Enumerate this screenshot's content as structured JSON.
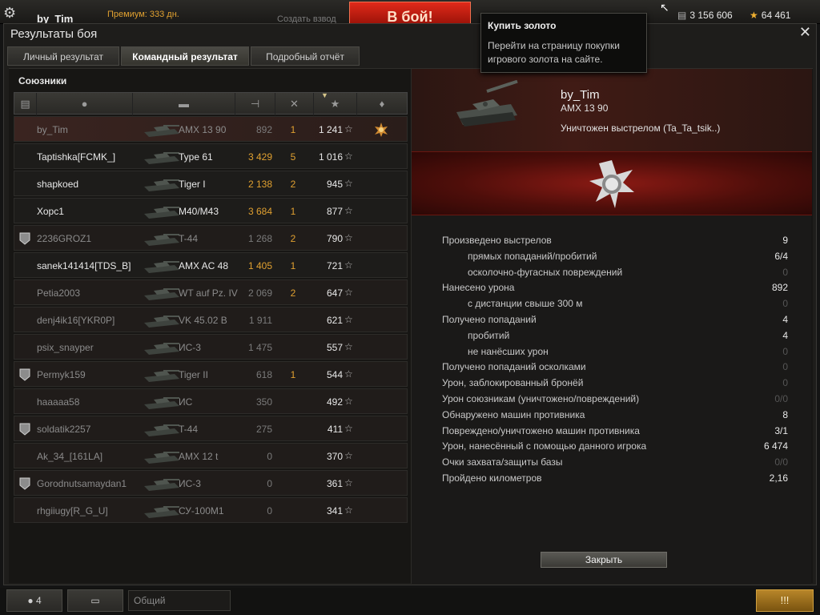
{
  "topbar": {
    "username": "by_Tim",
    "premium": "Премиум: 333 дн.",
    "create_platoon": "Создать взвод",
    "battle_button": "В бой!",
    "credits": "3 156 606",
    "gold": "64 461",
    "icons": {
      "settings": "gear-icon",
      "credits": "coins-icon",
      "gold": "gold-star-icon"
    }
  },
  "window": {
    "title": "Результаты боя",
    "close_glyph": "✕",
    "tabs": [
      {
        "label": "Личный результат"
      },
      {
        "label": "Командный результат"
      },
      {
        "label": "Подробный отчёт"
      }
    ]
  },
  "allies": {
    "title": "Союзники",
    "columns": [
      {
        "icon": "squad-icon"
      },
      {
        "icon": "player-icon"
      },
      {
        "icon": "tank-icon"
      },
      {
        "icon": "damage-icon"
      },
      {
        "icon": "frags-icon"
      },
      {
        "icon": "experience-star-icon"
      },
      {
        "icon": "medal-icon"
      }
    ],
    "rows": [
      {
        "name": "by_Tim",
        "tank": "AMX 13 90",
        "damage": "892",
        "kills": "1",
        "xp": "1 241",
        "alive": false,
        "me": true,
        "badge": "",
        "medal": true
      },
      {
        "name": "Taptishka[FCMK_]",
        "tank": "Type 61",
        "damage": "3 429",
        "kills": "5",
        "xp": "1 016",
        "alive": true,
        "badge": ""
      },
      {
        "name": "shapkoed",
        "tank": "Tiger I",
        "damage": "2 138",
        "kills": "2",
        "xp": "945",
        "alive": true,
        "badge": ""
      },
      {
        "name": "Хорс1",
        "tank": "M40/M43",
        "damage": "3 684",
        "kills": "1",
        "xp": "877",
        "alive": true,
        "badge": ""
      },
      {
        "name": "2236GROZ1",
        "tank": "T-44",
        "damage": "1 268",
        "kills": "2",
        "xp": "790",
        "alive": false,
        "badge": "1"
      },
      {
        "name": "sanek141414[TDS_B]",
        "tank": "AMX AC 48",
        "damage": "1 405",
        "kills": "1",
        "xp": "721",
        "alive": true,
        "badge": ""
      },
      {
        "name": "Petia2003",
        "tank": "WT auf Pz. IV",
        "damage": "2 069",
        "kills": "2",
        "xp": "647",
        "alive": false,
        "badge": ""
      },
      {
        "name": "denj4ik16[YKR0P]",
        "tank": "VK 45.02 B",
        "damage": "1 911",
        "kills": "",
        "xp": "621",
        "alive": false,
        "badge": ""
      },
      {
        "name": "psix_snayper",
        "tank": "ИС-3",
        "damage": "1 475",
        "kills": "",
        "xp": "557",
        "alive": false,
        "badge": ""
      },
      {
        "name": "Permyk159",
        "tank": "Tiger II",
        "damage": "618",
        "kills": "1",
        "xp": "544",
        "alive": false,
        "badge": "2"
      },
      {
        "name": "haaaaa58",
        "tank": "ИС",
        "damage": "350",
        "kills": "",
        "xp": "492",
        "alive": false,
        "badge": ""
      },
      {
        "name": "soldatik2257",
        "tank": "T-44",
        "damage": "275",
        "kills": "",
        "xp": "411",
        "alive": false,
        "badge": "1"
      },
      {
        "name": "Ak_34_[161LA]",
        "tank": "AMX 12 t",
        "damage": "0",
        "kills": "",
        "xp": "370",
        "alive": false,
        "badge": ""
      },
      {
        "name": "Gorodnutsamaydan1",
        "tank": "ИС-3",
        "damage": "0",
        "kills": "",
        "xp": "361",
        "alive": false,
        "badge": "2"
      },
      {
        "name": "rhgiiugy[R_G_U]",
        "tank": "СУ-100М1",
        "damage": "0",
        "kills": "",
        "xp": "341",
        "alive": false,
        "badge": ""
      }
    ]
  },
  "detail": {
    "player": "by_Tim",
    "tank": "AMX 13 90",
    "status": "Уничтожен выстрелом (Ta_Ta_tsik..)",
    "stats": [
      {
        "label": "Произведено выстрелов",
        "value": "9",
        "sub": false,
        "zero": false
      },
      {
        "label": "прямых попаданий/пробитий",
        "value": "6/4",
        "sub": true,
        "zero": false
      },
      {
        "label": "осколочно-фугасных повреждений",
        "value": "0",
        "sub": true,
        "zero": true
      },
      {
        "label": "Нанесено урона",
        "value": "892",
        "sub": false,
        "zero": false
      },
      {
        "label": "с дистанции свыше 300 м",
        "value": "0",
        "sub": true,
        "zero": true
      },
      {
        "label": "Получено попаданий",
        "value": "4",
        "sub": false,
        "zero": false
      },
      {
        "label": "пробитий",
        "value": "4",
        "sub": true,
        "zero": false
      },
      {
        "label": "не нанёсших урон",
        "value": "0",
        "sub": true,
        "zero": true
      },
      {
        "label": "Получено попаданий осколками",
        "value": "0",
        "sub": false,
        "zero": true
      },
      {
        "label": "Урон, заблокированный бронёй",
        "value": "0",
        "sub": false,
        "zero": true
      },
      {
        "label": "Урон союзникам (уничтожено/повреждений)",
        "value": "0/0",
        "sub": false,
        "zero": true
      },
      {
        "label": "Обнаружено машин противника",
        "value": "8",
        "sub": false,
        "zero": false
      },
      {
        "label": "Повреждено/уничтожено машин противника",
        "value": "3/1",
        "sub": false,
        "zero": false
      },
      {
        "label": "Урон, нанесённый с помощью данного игрока",
        "value": "6 474",
        "sub": false,
        "zero": false
      },
      {
        "label": "Очки захвата/защиты базы",
        "value": "0/0",
        "sub": false,
        "zero": true
      },
      {
        "label": "Пройдено километров",
        "value": "2,16",
        "sub": false,
        "zero": false
      }
    ],
    "close_button": "Закрыть"
  },
  "tooltip": {
    "title": "Купить золото",
    "body": "Перейти на страницу покупки игрового золота на сайте."
  },
  "bottombar": {
    "players_count": "4",
    "chat_placeholder": "Общий"
  },
  "colors": {
    "accent": "#e0a030",
    "battle": "#c81e10",
    "destroyed": "#8b8b8b"
  }
}
